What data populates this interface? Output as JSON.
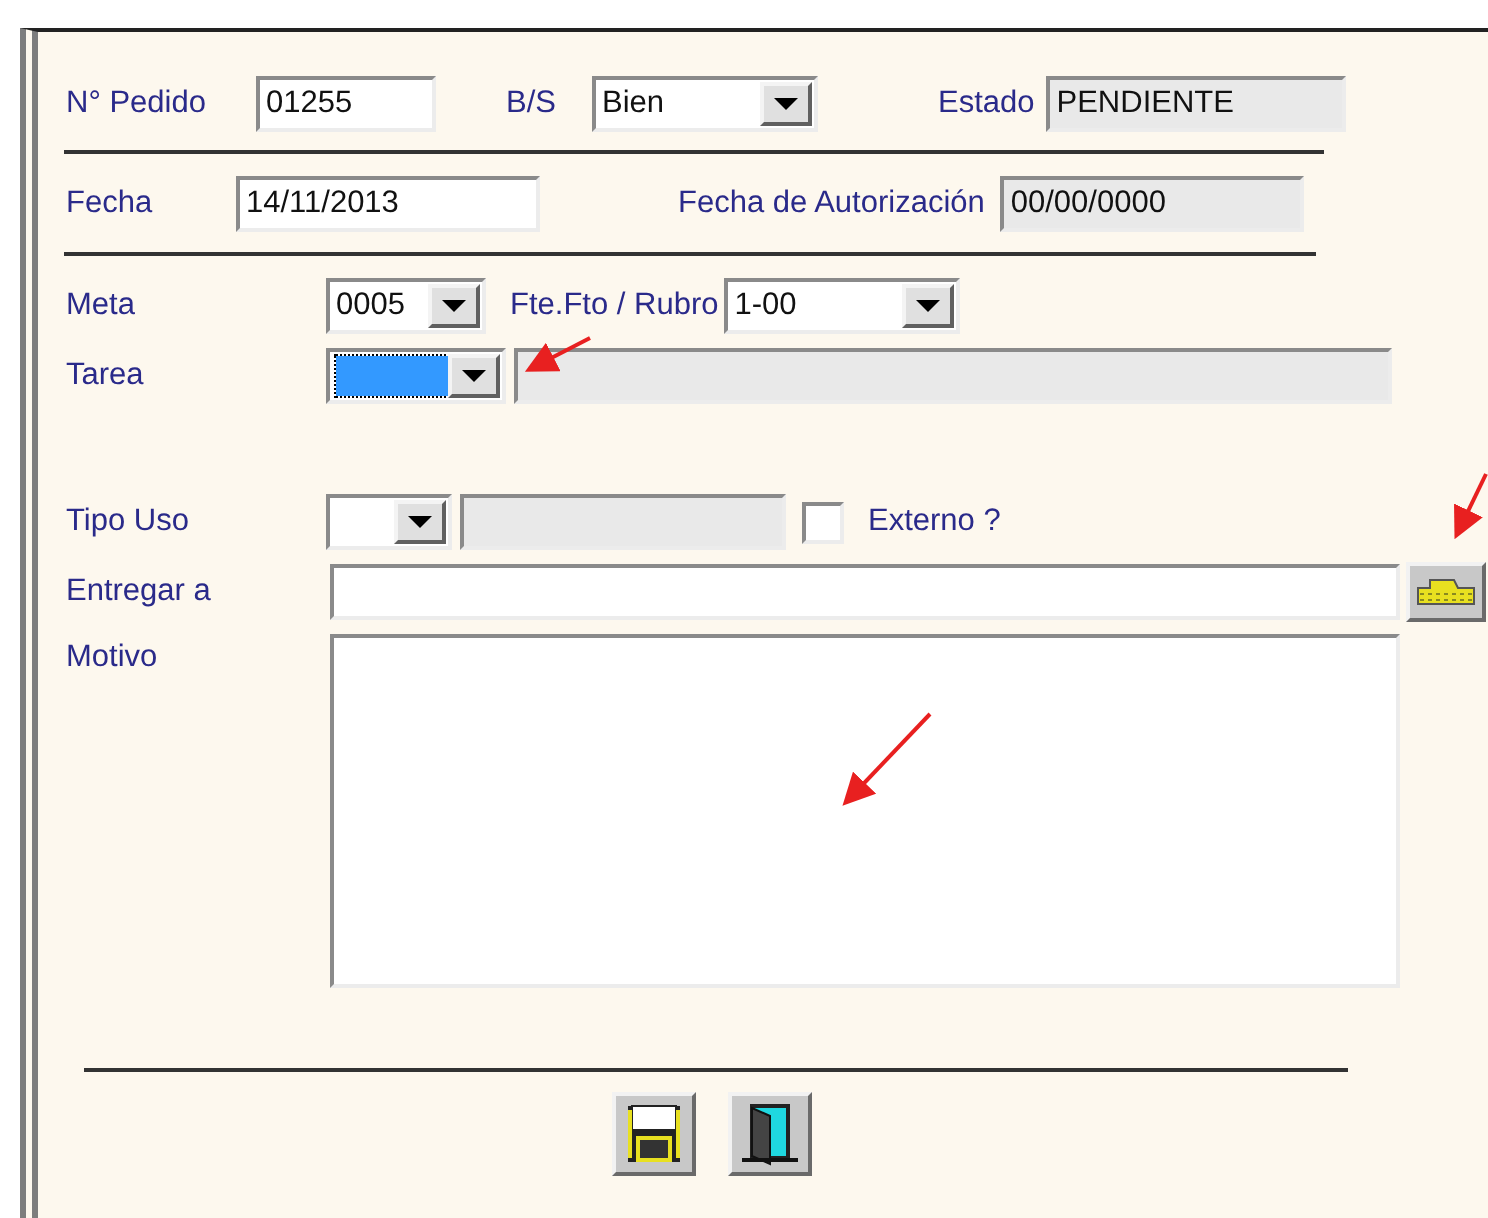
{
  "pedido": {
    "label": "N° Pedido",
    "value": "01255"
  },
  "bs": {
    "label": "B/S",
    "value": "Bien"
  },
  "estado": {
    "label": "Estado",
    "value": "PENDIENTE"
  },
  "fecha": {
    "label": "Fecha",
    "value": "14/11/2013"
  },
  "fecha_autorizacion": {
    "label": "Fecha de Autorización",
    "value": "00/00/0000"
  },
  "meta": {
    "label": "Meta",
    "value": "0005"
  },
  "fuente": {
    "label": "Fte.Fto / Rubro",
    "value": "1-00"
  },
  "tarea": {
    "label": "Tarea",
    "focused": true
  },
  "tipo_uso": {
    "label": "Tipo Uso"
  },
  "externo": {
    "label": "Externo ?",
    "checked": false
  },
  "entregar": {
    "label": "Entregar a"
  },
  "motivo": {
    "label": "Motivo"
  },
  "buttons": [
    {
      "kind": "save"
    },
    {
      "kind": "exit"
    }
  ]
}
